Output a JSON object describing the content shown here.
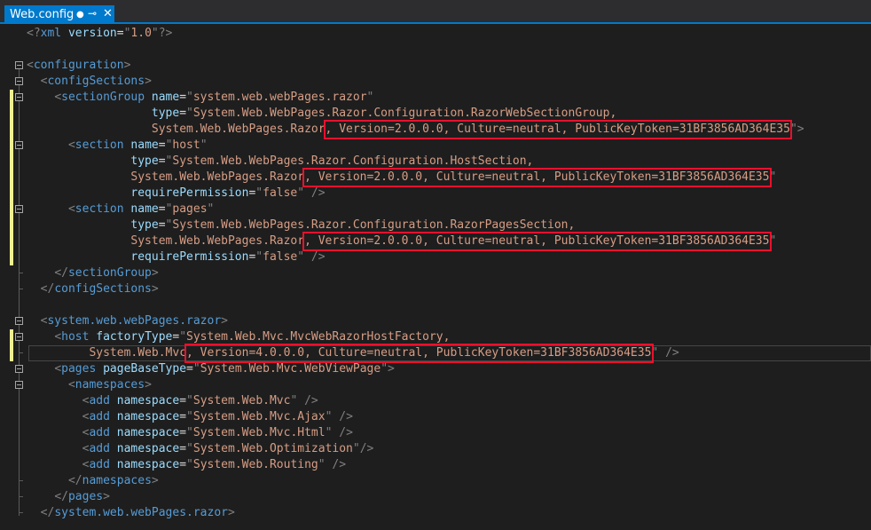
{
  "tab": {
    "title": "Web.config",
    "dirty_marker": "●",
    "pin_glyph": "⊸",
    "close_glyph": "✕"
  },
  "editor": {
    "lines": [
      [
        [
          "d",
          "<?"
        ],
        [
          "t",
          "xml "
        ],
        [
          "a",
          "version"
        ],
        [
          "x",
          "="
        ],
        [
          "d",
          "\""
        ],
        [
          "v",
          "1.0"
        ],
        [
          "d",
          "\""
        ],
        [
          "d",
          "?>"
        ]
      ],
      [],
      [
        [
          "d",
          "<"
        ],
        [
          "t",
          "configuration"
        ],
        [
          "d",
          ">"
        ]
      ],
      [
        [
          "x",
          "  "
        ],
        [
          "d",
          "<"
        ],
        [
          "t",
          "configSections"
        ],
        [
          "d",
          ">"
        ]
      ],
      [
        [
          "x",
          "    "
        ],
        [
          "d",
          "<"
        ],
        [
          "t",
          "sectionGroup "
        ],
        [
          "a",
          "name"
        ],
        [
          "x",
          "="
        ],
        [
          "d",
          "\""
        ],
        [
          "v",
          "system.web.webPages.razor"
        ],
        [
          "d",
          "\""
        ]
      ],
      [
        [
          "x",
          "                  "
        ],
        [
          "a",
          "type"
        ],
        [
          "x",
          "="
        ],
        [
          "d",
          "\""
        ],
        [
          "v",
          "System.Web.WebPages.Razor.Configuration.RazorWebSectionGroup,"
        ]
      ],
      [
        [
          "x",
          "                  "
        ],
        [
          "v",
          "System.Web.WebPages.Razor, Version=2.0.0.0, Culture=neutral, PublicKeyToken=31BF3856AD364E35"
        ],
        [
          "d",
          "\">"
        ]
      ],
      [
        [
          "x",
          "      "
        ],
        [
          "d",
          "<"
        ],
        [
          "t",
          "section "
        ],
        [
          "a",
          "name"
        ],
        [
          "x",
          "="
        ],
        [
          "d",
          "\""
        ],
        [
          "v",
          "host"
        ],
        [
          "d",
          "\""
        ]
      ],
      [
        [
          "x",
          "               "
        ],
        [
          "a",
          "type"
        ],
        [
          "x",
          "="
        ],
        [
          "d",
          "\""
        ],
        [
          "v",
          "System.Web.WebPages.Razor.Configuration.HostSection,"
        ]
      ],
      [
        [
          "x",
          "               "
        ],
        [
          "v",
          "System.Web.WebPages.Razor, Version=2.0.0.0, Culture=neutral, PublicKeyToken=31BF3856AD364E35"
        ],
        [
          "d",
          "\""
        ]
      ],
      [
        [
          "x",
          "               "
        ],
        [
          "a",
          "requirePermission"
        ],
        [
          "x",
          "="
        ],
        [
          "d",
          "\""
        ],
        [
          "v",
          "false"
        ],
        [
          "d",
          "\""
        ],
        [
          "d",
          " />"
        ]
      ],
      [
        [
          "x",
          "      "
        ],
        [
          "d",
          "<"
        ],
        [
          "t",
          "section "
        ],
        [
          "a",
          "name"
        ],
        [
          "x",
          "="
        ],
        [
          "d",
          "\""
        ],
        [
          "v",
          "pages"
        ],
        [
          "d",
          "\""
        ]
      ],
      [
        [
          "x",
          "               "
        ],
        [
          "a",
          "type"
        ],
        [
          "x",
          "="
        ],
        [
          "d",
          "\""
        ],
        [
          "v",
          "System.Web.WebPages.Razor.Configuration.RazorPagesSection,"
        ]
      ],
      [
        [
          "x",
          "               "
        ],
        [
          "v",
          "System.Web.WebPages.Razor, Version=2.0.0.0, Culture=neutral, PublicKeyToken=31BF3856AD364E35"
        ],
        [
          "d",
          "\""
        ]
      ],
      [
        [
          "x",
          "               "
        ],
        [
          "a",
          "requirePermission"
        ],
        [
          "x",
          "="
        ],
        [
          "d",
          "\""
        ],
        [
          "v",
          "false"
        ],
        [
          "d",
          "\""
        ],
        [
          "d",
          " />"
        ]
      ],
      [
        [
          "x",
          "    "
        ],
        [
          "d",
          "</"
        ],
        [
          "t",
          "sectionGroup"
        ],
        [
          "d",
          ">"
        ]
      ],
      [
        [
          "x",
          "  "
        ],
        [
          "d",
          "</"
        ],
        [
          "t",
          "configSections"
        ],
        [
          "d",
          ">"
        ]
      ],
      [],
      [
        [
          "x",
          "  "
        ],
        [
          "d",
          "<"
        ],
        [
          "t",
          "system.web.webPages.razor"
        ],
        [
          "d",
          ">"
        ]
      ],
      [
        [
          "x",
          "    "
        ],
        [
          "d",
          "<"
        ],
        [
          "t",
          "host "
        ],
        [
          "a",
          "factoryType"
        ],
        [
          "x",
          "="
        ],
        [
          "d",
          "\""
        ],
        [
          "v",
          "System.Web.Mvc.MvcWebRazorHostFactory,"
        ]
      ],
      [
        [
          "x",
          "         "
        ],
        [
          "v",
          "System.Web.Mvc, Version=4.0.0.0, Culture=neutral, PublicKeyToken=31BF3856AD364E35"
        ],
        [
          "d",
          "\""
        ],
        [
          "d",
          " />"
        ]
      ],
      [
        [
          "x",
          "    "
        ],
        [
          "d",
          "<"
        ],
        [
          "t",
          "pages "
        ],
        [
          "a",
          "pageBaseType"
        ],
        [
          "x",
          "="
        ],
        [
          "d",
          "\""
        ],
        [
          "v",
          "System.Web.Mvc.WebViewPage"
        ],
        [
          "d",
          "\">"
        ]
      ],
      [
        [
          "x",
          "      "
        ],
        [
          "d",
          "<"
        ],
        [
          "t",
          "namespaces"
        ],
        [
          "d",
          ">"
        ]
      ],
      [
        [
          "x",
          "        "
        ],
        [
          "d",
          "<"
        ],
        [
          "t",
          "add "
        ],
        [
          "a",
          "namespace"
        ],
        [
          "x",
          "="
        ],
        [
          "d",
          "\""
        ],
        [
          "v",
          "System.Web.Mvc"
        ],
        [
          "d",
          "\""
        ],
        [
          "d",
          " />"
        ]
      ],
      [
        [
          "x",
          "        "
        ],
        [
          "d",
          "<"
        ],
        [
          "t",
          "add "
        ],
        [
          "a",
          "namespace"
        ],
        [
          "x",
          "="
        ],
        [
          "d",
          "\""
        ],
        [
          "v",
          "System.Web.Mvc.Ajax"
        ],
        [
          "d",
          "\""
        ],
        [
          "d",
          " />"
        ]
      ],
      [
        [
          "x",
          "        "
        ],
        [
          "d",
          "<"
        ],
        [
          "t",
          "add "
        ],
        [
          "a",
          "namespace"
        ],
        [
          "x",
          "="
        ],
        [
          "d",
          "\""
        ],
        [
          "v",
          "System.Web.Mvc.Html"
        ],
        [
          "d",
          "\""
        ],
        [
          "d",
          " />"
        ]
      ],
      [
        [
          "x",
          "        "
        ],
        [
          "d",
          "<"
        ],
        [
          "t",
          "add "
        ],
        [
          "a",
          "namespace"
        ],
        [
          "x",
          "="
        ],
        [
          "d",
          "\""
        ],
        [
          "v",
          "System.Web.Optimization"
        ],
        [
          "d",
          "\""
        ],
        [
          "d",
          "/>"
        ]
      ],
      [
        [
          "x",
          "        "
        ],
        [
          "d",
          "<"
        ],
        [
          "t",
          "add "
        ],
        [
          "a",
          "namespace"
        ],
        [
          "x",
          "="
        ],
        [
          "d",
          "\""
        ],
        [
          "v",
          "System.Web.Routing"
        ],
        [
          "d",
          "\""
        ],
        [
          "d",
          " />"
        ]
      ],
      [
        [
          "x",
          "      "
        ],
        [
          "d",
          "</"
        ],
        [
          "t",
          "namespaces"
        ],
        [
          "d",
          ">"
        ]
      ],
      [
        [
          "x",
          "    "
        ],
        [
          "d",
          "</"
        ],
        [
          "t",
          "pages"
        ],
        [
          "d",
          ">"
        ]
      ],
      [
        [
          "x",
          "  "
        ],
        [
          "d",
          "</"
        ],
        [
          "t",
          "system.web.webPages.razor"
        ],
        [
          "d",
          ">"
        ]
      ]
    ]
  }
}
